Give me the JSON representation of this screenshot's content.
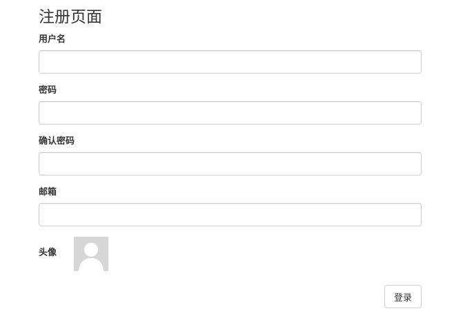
{
  "page": {
    "title": "注册页面"
  },
  "form": {
    "fields": [
      {
        "label": "用户名",
        "value": "",
        "placeholder": ""
      },
      {
        "label": "密码",
        "value": "",
        "placeholder": ""
      },
      {
        "label": "确认密码",
        "value": "",
        "placeholder": ""
      },
      {
        "label": "邮箱",
        "value": "",
        "placeholder": ""
      }
    ],
    "avatar": {
      "label": "头像",
      "icon": "default-user-avatar-icon"
    },
    "submit_label": "登录"
  }
}
